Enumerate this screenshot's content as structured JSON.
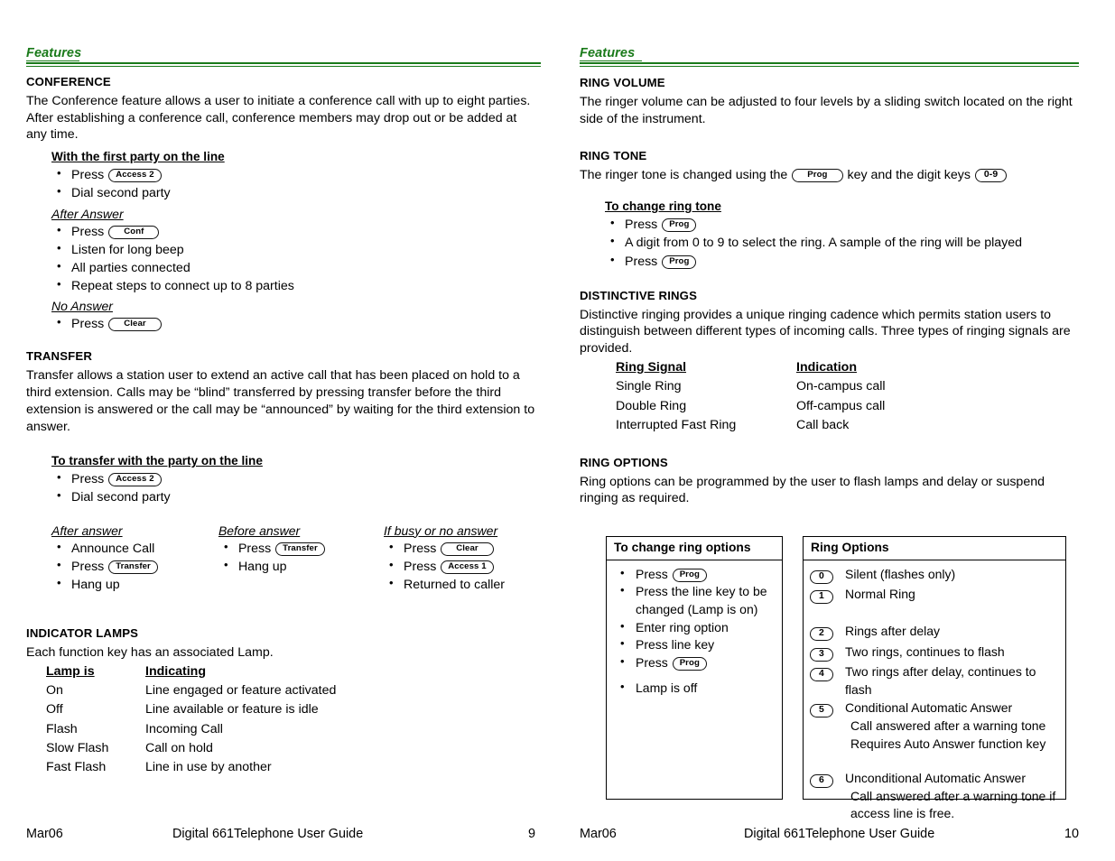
{
  "document": {
    "title": "Digital 661Telephone User Guide",
    "date": "Mar06",
    "accent_green": "#1a7a1a"
  },
  "left_page": {
    "running_head": "Features",
    "page_number": "9",
    "sections": [
      {
        "title": "CONFERENCE",
        "body": "The Conference feature allows a user to initiate a conference call with up to eight parties. After establishing a conference call, conference members may drop out or be added at any time.",
        "sub_heading": "With the first party on the line",
        "first_steps": [
          "Press",
          "Dial second party"
        ],
        "first_key": "Access 2",
        "after_answer_label": "After Answer",
        "after_answer_items": [
          "Press",
          "Listen for long beep",
          "All parties connected",
          "Repeat steps to connect up to 8 parties"
        ],
        "after_answer_key": "Conf",
        "no_answer_label": "No Answer",
        "no_answer_item": "Press",
        "no_answer_key": "Clear"
      },
      {
        "title": "TRANSFER",
        "body": "Transfer allows a station user to extend an active call that has been placed on hold to a third extension. Calls may be “blind” transferred by pressing transfer before the third extension is answered or the call may be “announced” by waiting for the third extension to answer.",
        "sub_heading": "To transfer with the party on the line",
        "steps": [
          "Press",
          "Dial second party"
        ],
        "step_key": "Access 2",
        "columns": [
          {
            "heading": "After answer",
            "items": [
              {
                "text": "Announce Call",
                "key": ""
              },
              {
                "text": "Press",
                "key": "Transfer"
              },
              {
                "text": "Hang up",
                "key": ""
              }
            ]
          },
          {
            "heading": "Before answer",
            "items": [
              {
                "text": "Press",
                "key": "Transfer"
              },
              {
                "text": "Hang up",
                "key": ""
              }
            ]
          },
          {
            "heading": "If busy or no answer",
            "items": [
              {
                "text": "Press",
                "key": "Clear"
              },
              {
                "text": "Press",
                "key": "Access 1"
              },
              {
                "text": "Returned to caller",
                "key": ""
              }
            ]
          }
        ]
      },
      {
        "title": "INDICATOR LAMPS",
        "body": "Each function key has an associated Lamp.",
        "table": {
          "headers": [
            "Lamp is",
            "Indicating"
          ],
          "rows": [
            [
              "On",
              "Line engaged or feature activated"
            ],
            [
              "Off",
              "Line available or feature is idle"
            ],
            [
              "Flash",
              "Incoming Call"
            ],
            [
              "Slow Flash",
              "Call on hold"
            ],
            [
              "Fast Flash",
              "Line in use by another"
            ]
          ]
        }
      }
    ]
  },
  "right_page": {
    "running_head": "Features",
    "page_number": "10",
    "ring_volume": {
      "title": "RING VOLUME",
      "body": "The ringer volume can be adjusted to four levels by a sliding switch located on the right side of the instrument."
    },
    "ring_tone": {
      "title": "RING TONE",
      "intro_part1": "The ringer tone is changed using the",
      "intro_key1": "Prog",
      "intro_part2": "key and the digit keys",
      "intro_key2": "0-9",
      "sub_heading": "To change ring tone",
      "steps": [
        {
          "text": "Press",
          "key": "Prog"
        },
        {
          "text": "A digit from 0 to 9 to select the ring.  A sample of the ring will be played",
          "key": ""
        },
        {
          "text": "Press",
          "key": "Prog"
        }
      ]
    },
    "distinctive_rings": {
      "title": "DISTINCTIVE RINGS",
      "body": "Distinctive ringing provides a unique ringing cadence which permits station users to distinguish between different types of incoming calls.  Three types of ringing signals are provided.",
      "table": {
        "headers": [
          "Ring Signal",
          "Indication"
        ],
        "rows": [
          [
            "Single Ring",
            "On-campus call"
          ],
          [
            "Double Ring",
            "Off-campus call"
          ],
          [
            "Interrupted Fast Ring",
            "Call back"
          ]
        ]
      }
    },
    "ring_options": {
      "title": "RING OPTIONS",
      "body": "Ring options can be programmed by the user to flash lamps and delay or suspend ringing as required.",
      "left_box": {
        "header": "To change ring options",
        "items": [
          {
            "text": "Press",
            "key": "Prog",
            "extra": ""
          },
          {
            "text": "Press the line key to be changed",
            "key": "",
            "extra": "(Lamp is on)"
          },
          {
            "text": "Enter ring option",
            "key": "",
            "extra": ""
          },
          {
            "text": "Press line key",
            "key": "",
            "extra": ""
          },
          {
            "text": "Press",
            "key": "Prog",
            "extra": ""
          }
        ],
        "final_item": "Lamp is off"
      },
      "right_box": {
        "header": "Ring Options",
        "options": [
          {
            "digit": "0",
            "text": "Silent (flashes only)",
            "sublines": [],
            "gap_after": false
          },
          {
            "digit": "1",
            "text": "Normal Ring",
            "sublines": [],
            "gap_after": true
          },
          {
            "digit": "2",
            "text": "Rings after delay",
            "sublines": [],
            "gap_after": false
          },
          {
            "digit": "3",
            "text": "Two rings, continues to flash",
            "sublines": [],
            "gap_after": false
          },
          {
            "digit": "4",
            "text": "Two rings after delay, continues to flash",
            "sublines": [],
            "gap_after": false
          },
          {
            "digit": "5",
            "text": "Conditional Automatic Answer",
            "sublines": [
              "Call answered after a warning tone",
              "Requires Auto Answer function key"
            ],
            "gap_after": true
          },
          {
            "digit": "6",
            "text": "Unconditional Automatic Answer",
            "sublines": [
              "Call answered after a warning tone if access line is free."
            ],
            "gap_after": false
          }
        ]
      }
    }
  }
}
